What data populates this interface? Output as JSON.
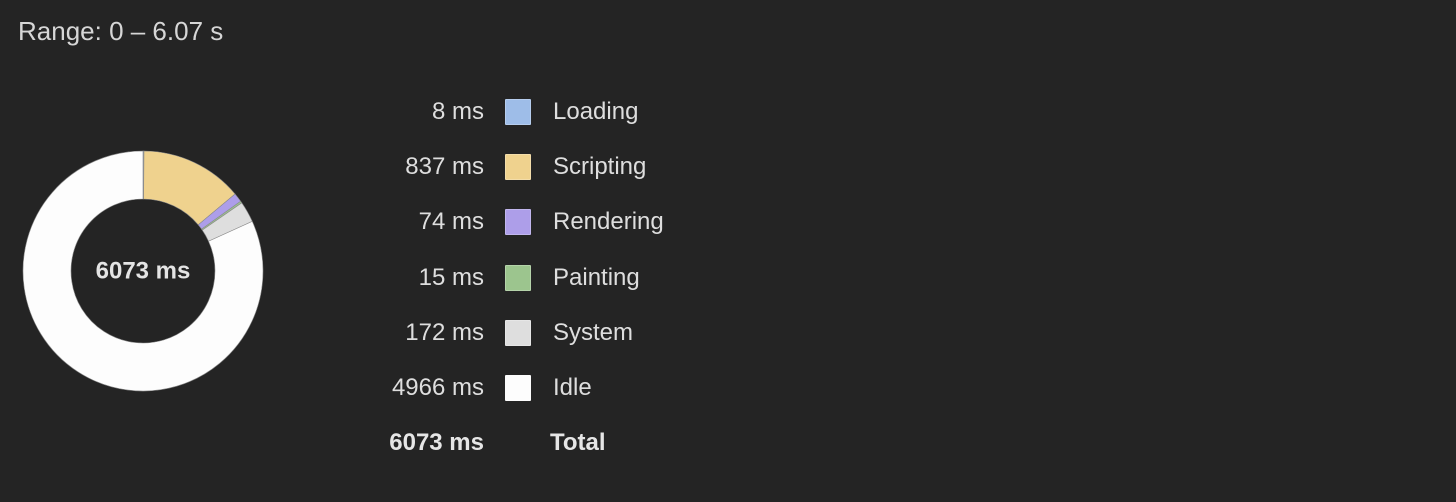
{
  "range_text": "Range: 0 – 6.07 s",
  "chart_data": {
    "type": "pie",
    "donut": true,
    "center_label": "6073 ms",
    "unit": "ms",
    "slices": [
      {
        "name": "Loading",
        "value": 8,
        "value_text": "8 ms",
        "color": "#9ebde8"
      },
      {
        "name": "Scripting",
        "value": 837,
        "value_text": "837 ms",
        "color": "#efd28e"
      },
      {
        "name": "Rendering",
        "value": 74,
        "value_text": "74 ms",
        "color": "#ad9ee9"
      },
      {
        "name": "Painting",
        "value": 15,
        "value_text": "15 ms",
        "color": "#9cc58e"
      },
      {
        "name": "System",
        "value": 172,
        "value_text": "172 ms",
        "color": "#dedede"
      },
      {
        "name": "Idle",
        "value": 4966,
        "value_text": "4966 ms",
        "color": "#fdfdfd"
      }
    ],
    "total": {
      "label": "Total",
      "value": 6073,
      "value_text": "6073 ms"
    }
  }
}
